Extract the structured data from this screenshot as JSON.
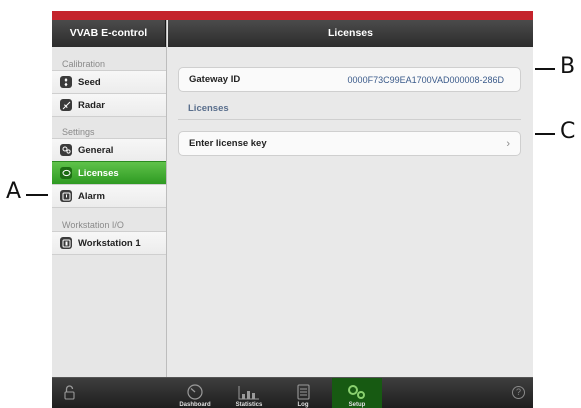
{
  "sidebar": {
    "title": "VVAB E-control",
    "sections": [
      {
        "label": "Calibration",
        "items": [
          "Seed",
          "Radar"
        ]
      },
      {
        "label": "Settings",
        "items": [
          "General",
          "Licenses",
          "Alarm"
        ]
      },
      {
        "label": "Workstation I/O",
        "items": [
          "Workstation 1"
        ]
      }
    ],
    "active_item": "Licenses"
  },
  "main": {
    "title": "Licenses",
    "gateway": {
      "label": "Gateway ID",
      "value": "0000F73C99EA1700VAD000008-286D"
    },
    "group_title": "Licenses",
    "license_row": {
      "label": "Enter license key",
      "chevron": "›"
    }
  },
  "tabbar": {
    "tabs": [
      "Dashboard",
      "Statistics",
      "Log",
      "Setup"
    ],
    "active": "Setup",
    "help": "?"
  },
  "callouts": {
    "a": "A",
    "b": "B",
    "c": "C"
  },
  "colors": {
    "accent_red": "#c4242c",
    "active_green": "#3aa82a",
    "setup_tab": "#175a12"
  }
}
